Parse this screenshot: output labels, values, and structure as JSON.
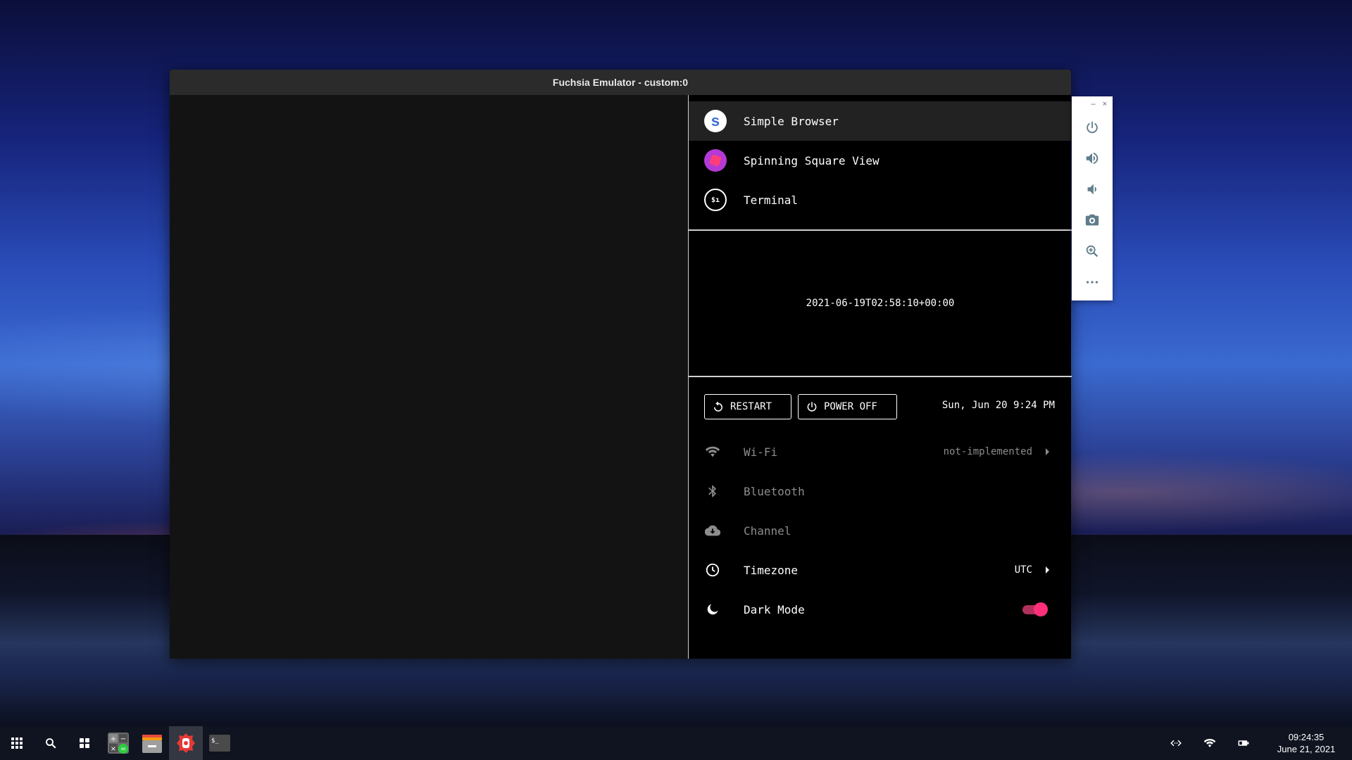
{
  "window": {
    "title": "Fuchsia Emulator - custom:0"
  },
  "apps": [
    {
      "name": "Simple Browser",
      "icon": "s"
    },
    {
      "name": "Spinning Square View",
      "icon": ""
    },
    {
      "name": "Terminal",
      "icon": "$ı"
    }
  ],
  "clock_text": "2021-06-19T02:58:10+00:00",
  "controls": {
    "restart": "RESTART",
    "power_off": "POWER OFF",
    "datetime": "Sun, Jun 20 9:24 PM"
  },
  "settings": {
    "wifi": {
      "label": "Wi-Fi",
      "value": "not-implemented"
    },
    "bluetooth": {
      "label": "Bluetooth"
    },
    "channel": {
      "label": "Channel"
    },
    "timezone": {
      "label": "Timezone",
      "value": "UTC"
    },
    "dark_mode": {
      "label": "Dark Mode",
      "enabled": true
    }
  },
  "toolbar_controls": {
    "minimize": "–",
    "close": "×"
  },
  "taskbar": {
    "time": "09:24:35",
    "date": "June 21, 2021",
    "terminal_glyph": "$_"
  },
  "colors": {
    "accent": "#ff2f7a",
    "window_bg": "#131313",
    "panel_bg": "#000000"
  }
}
